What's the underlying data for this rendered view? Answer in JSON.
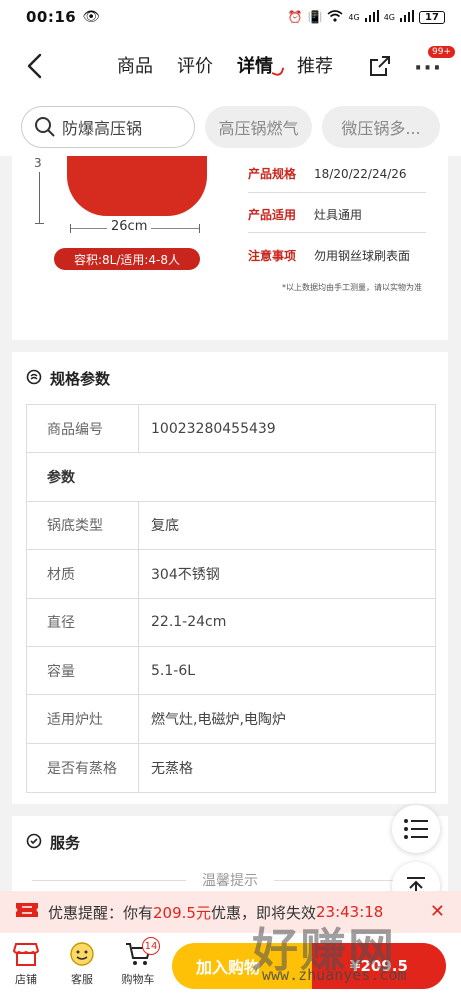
{
  "status_bar": {
    "time": "00:16",
    "network_1": "4G",
    "network_2": "4G",
    "battery": "17"
  },
  "nav": {
    "tabs": [
      {
        "label": "商品"
      },
      {
        "label": "评价"
      },
      {
        "label": "详情"
      },
      {
        "label": "推荐"
      }
    ],
    "active_tab": "详情",
    "more_badge": "99+"
  },
  "search_chips": [
    {
      "label": "防爆高压锅"
    },
    {
      "label": "高压锅燃气"
    },
    {
      "label": "微压锅多..."
    }
  ],
  "product_image": {
    "height_mark": "3",
    "width_label": "26cm",
    "capacity_tag": "容积:8L/适用:4-8人",
    "specs": [
      {
        "key": "产品规格",
        "value": "18/20/22/24/26"
      },
      {
        "key": "产品适用",
        "value": "灶具通用"
      },
      {
        "key": "注意事项",
        "value": "勿用钢丝球刷表面"
      }
    ],
    "note": "*以上数据均由手工测量，请以实物为准"
  },
  "params": {
    "title": "规格参数",
    "rows": [
      {
        "key": "商品编号",
        "value": "10023280455439"
      },
      {
        "key": "参数",
        "value": ""
      },
      {
        "key": "锅底类型",
        "value": "复底"
      },
      {
        "key": "材质",
        "value": "304不锈钢"
      },
      {
        "key": "直径",
        "value": "22.1-24cm"
      },
      {
        "key": "容量",
        "value": "5.1-6L"
      },
      {
        "key": "适用炉灶",
        "value": "燃气灶,电磁炉,电陶炉"
      },
      {
        "key": "是否有蒸格",
        "value": "无蒸格"
      }
    ]
  },
  "service": {
    "title": "服务",
    "tip": "温馨提示"
  },
  "promo": {
    "prefix": "优惠提醒：你有",
    "amount": "209.5元",
    "middle": "优惠，即将失效",
    "countdown": "23:43:18"
  },
  "bottom_bar": {
    "shop_label": "店铺",
    "service_label": "客服",
    "cart_label": "购物车",
    "cart_count": "14",
    "add_cart_label": "加入购物",
    "buy_label": "¥209.5"
  },
  "watermark": {
    "brand": "好赚网",
    "url": "www.zhuanyes.com"
  },
  "colors": {
    "accent": "#e1251b",
    "cart_button": "#ffc107",
    "spec_key": "#c8261d"
  }
}
